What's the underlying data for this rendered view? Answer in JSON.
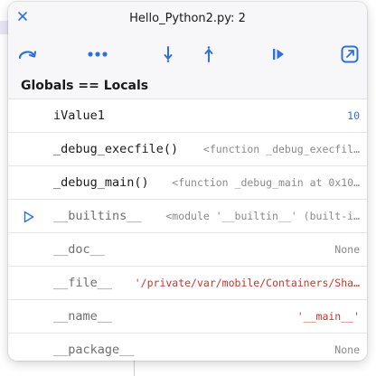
{
  "window": {
    "title": "Hello_Python2.py: 2"
  },
  "toolbar": {
    "icons": [
      "step-over-icon",
      "more-icon",
      "step-into-icon",
      "step-out-icon",
      "continue-icon",
      "expand-icon"
    ]
  },
  "section": {
    "title": "Globals == Locals"
  },
  "variables": [
    {
      "name": "iValue1",
      "value": "10",
      "kind": "number"
    },
    {
      "name": "_debug_execfile()",
      "value": "<function _debug_execfil…",
      "kind": "plain"
    },
    {
      "name": "_debug_main()",
      "value": "<function _debug_main at 0x10…",
      "kind": "plain"
    },
    {
      "name": "__builtins__",
      "value": "<module '__builtin__' (built-i…",
      "kind": "plain",
      "expandable": true
    },
    {
      "name": "__doc__",
      "value": "None",
      "kind": "plain"
    },
    {
      "name": "__file__",
      "value": "'/private/var/mobile/Containers/Sha…",
      "kind": "string"
    },
    {
      "name": "__name__",
      "value": "'__main__'",
      "kind": "string"
    },
    {
      "name": "__package__",
      "value": "None",
      "kind": "plain"
    }
  ],
  "colors": {
    "accent": "#2f71d6",
    "string": "#c5372c",
    "muted": "#8a8a8a"
  }
}
